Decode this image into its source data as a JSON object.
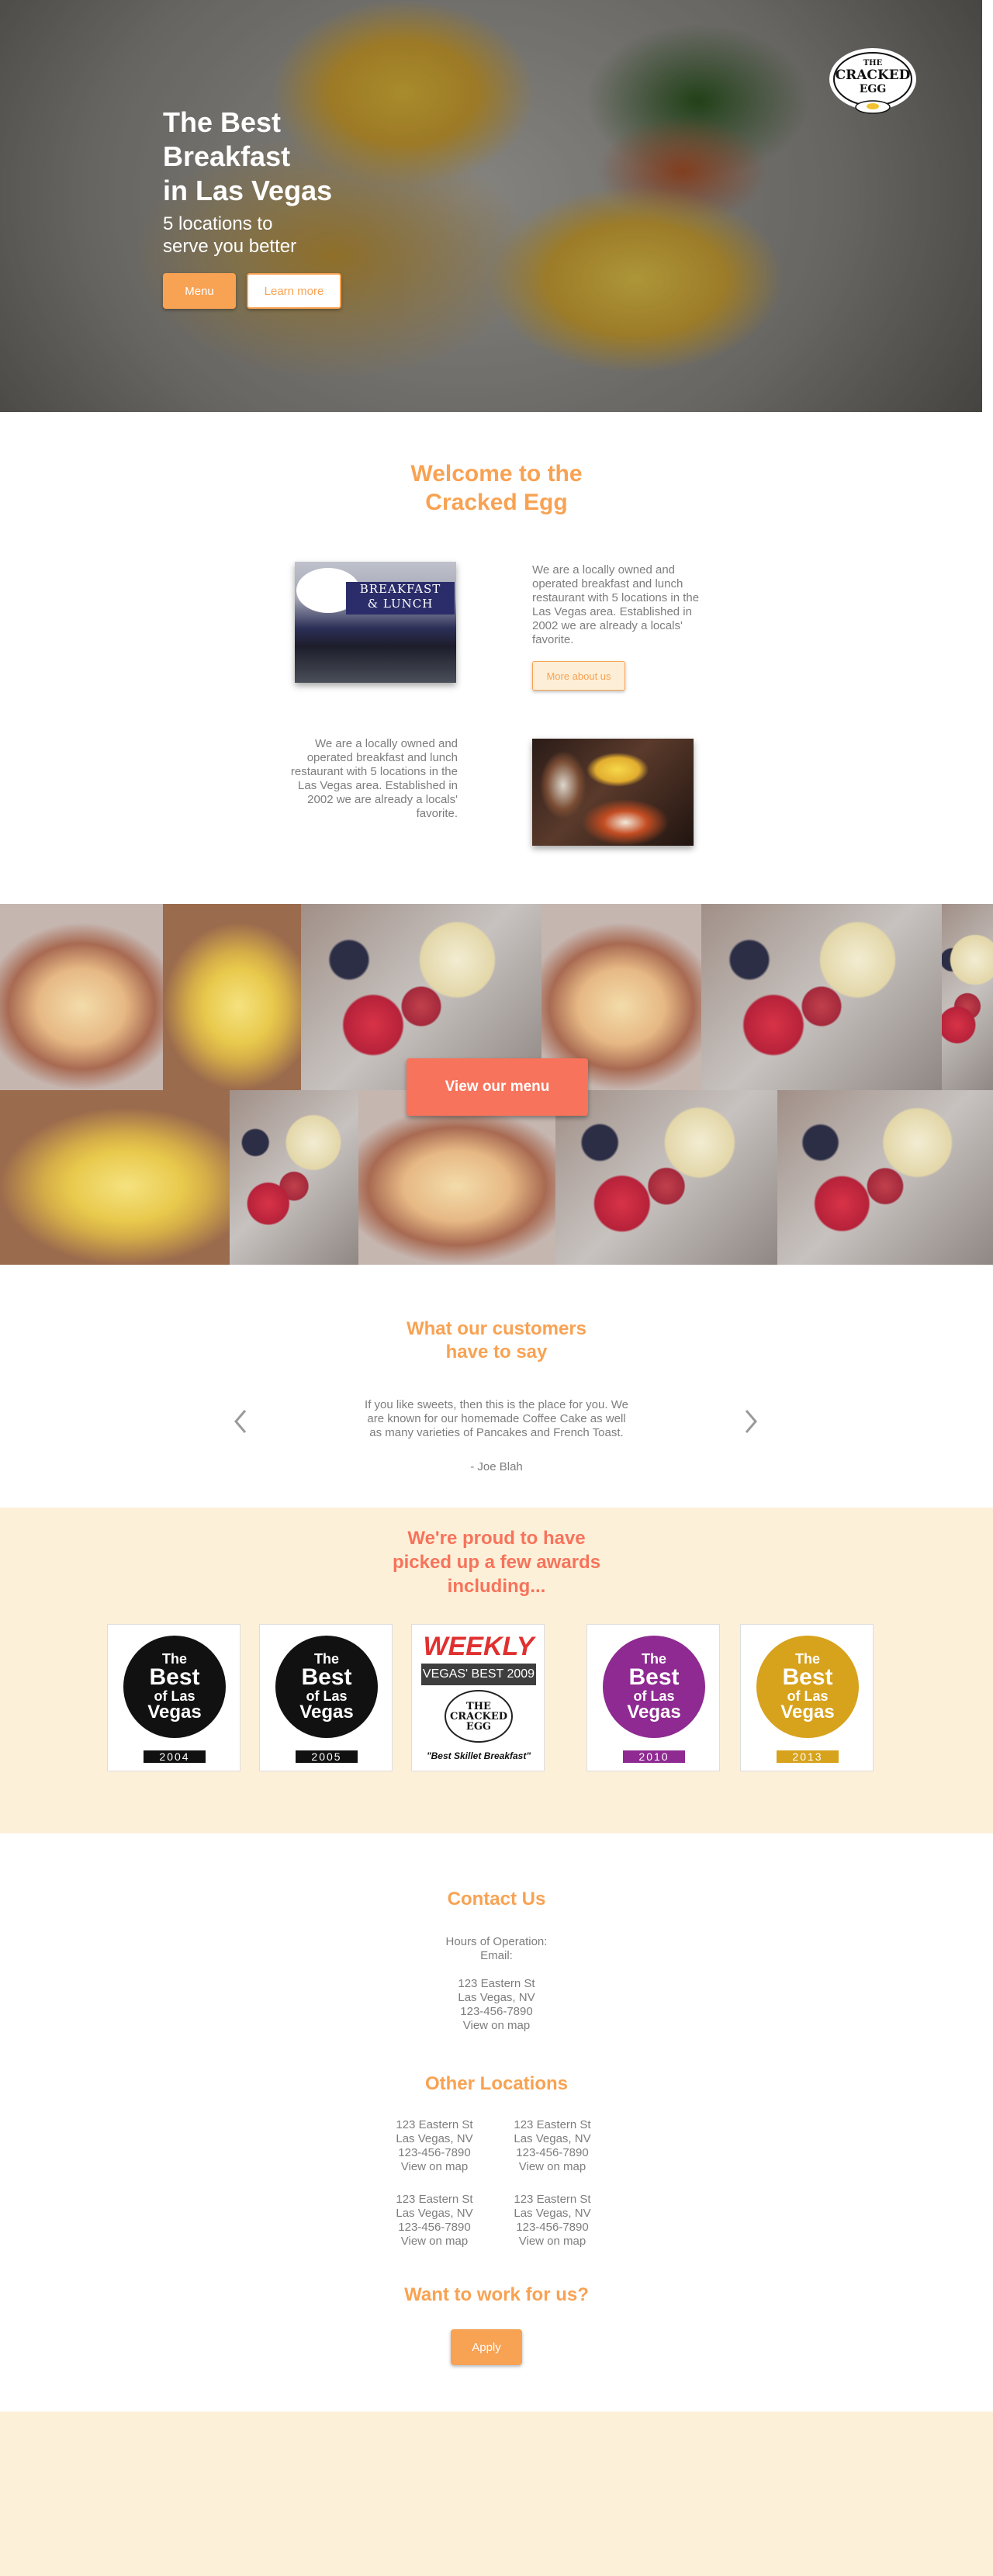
{
  "hero": {
    "title": "The Best\nBreakfast\nin Las Vegas",
    "subtitle": "5 locations to\nserve you better",
    "menu_label": "Menu",
    "learn_label": "Learn more",
    "logo_text_top": "THE",
    "logo_text_main": "CRACKED",
    "logo_text_bottom": "EGG"
  },
  "welcome": {
    "title": "Welcome to the\nCracked Egg",
    "store_sign": "BREAKFAST\n& LUNCH",
    "paragraph_1": "We are a locally owned and\noperated breakfast and lunch\nrestaurant with 5 locations in the\nLas Vegas area. Established in\n2002 we are already a locals'\nfavorite.",
    "about_label": "More about us",
    "paragraph_2": "We are a locally owned and\noperated breakfast and lunch\nrestaurant with 5 locations in the\nLas Vegas area. Established in\n2002 we are already a locals'\nfavorite."
  },
  "menu_banner": {
    "button_label": "View our menu"
  },
  "testimonials": {
    "title": "What our customers\nhave to say",
    "quote": "If you like sweets, then this is the place for you. We are known for our homemade Coffee Cake as well as many varieties of Pancakes and French Toast.",
    "author": "- Joe Blah"
  },
  "awards": {
    "title": "We're proud to have\npicked up a few awards\nincluding...",
    "items": [
      {
        "word1": "The",
        "word2": "Best",
        "word3": "of Las",
        "word4": "Vegas",
        "year": "2004",
        "color": "#111111"
      },
      {
        "word1": "The",
        "word2": "Best",
        "word3": "of Las",
        "word4": "Vegas",
        "year": "2005",
        "color": "#111111"
      },
      {
        "head": "WEEKLY",
        "band": "VEGAS' BEST 2009",
        "egg": "THE\nCRACKED\nEGG",
        "caption": "\"Best Skillet Breakfast\""
      },
      {
        "word1": "The",
        "word2": "Best",
        "word3": "of Las",
        "word4": "Vegas",
        "year": "2010",
        "color": "#8e2a91"
      },
      {
        "word1": "The",
        "word2": "Best",
        "word3": "of Las",
        "word4": "Vegas",
        "year": "2013",
        "color": "#d7a21c"
      }
    ]
  },
  "contact": {
    "title": "Contact Us",
    "hours_label": "Hours of Operation:",
    "email_label": "Email:",
    "street": "123 Eastern St",
    "city": "Las Vegas, NV",
    "phone": "123-456-7890",
    "map_link": "View on map"
  },
  "other_locations": {
    "title": "Other Locations",
    "items": [
      {
        "street": "123 Eastern St",
        "city": "Las Vegas, NV",
        "phone": "123-456-7890",
        "map": "View on map"
      },
      {
        "street": "123 Eastern St",
        "city": "Las Vegas, NV",
        "phone": "123-456-7890",
        "map": "View on map"
      },
      {
        "street": "123 Eastern St",
        "city": "Las Vegas, NV",
        "phone": "123-456-7890",
        "map": "View on map"
      },
      {
        "street": "123 Eastern St",
        "city": "Las Vegas, NV",
        "phone": "123-456-7890",
        "map": "View on map"
      }
    ]
  },
  "careers": {
    "title": "Want to work for us?",
    "apply_label": "Apply"
  },
  "colors": {
    "accent": "#f8a253",
    "coral": "#f7735b",
    "cream": "#fdf0d9"
  }
}
